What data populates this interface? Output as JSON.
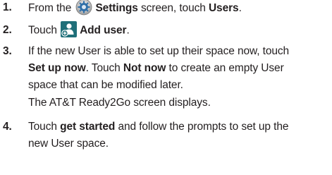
{
  "steps": [
    {
      "number": "1.",
      "text_before": "From the",
      "icon": "settings-gear-icon",
      "bold_label": "Settings",
      "text_after": " screen, touch ",
      "bold_target": "Users",
      "end": "."
    },
    {
      "number": "2.",
      "text_before": "Touch",
      "icon": "add-user-icon",
      "bold_label": "Add user",
      "end": "."
    },
    {
      "number": "3.",
      "line1": "If the new User is able to set up their space now, touch",
      "line2_bold": "Set up now",
      "line2_mid": ". Touch ",
      "line2_bold2": "Not now",
      "line2_end": " to create an empty User",
      "line3": "space that can be modified later.",
      "line4": "The AT&T Ready2Go screen displays."
    },
    {
      "number": "4.",
      "line1_before": "Touch ",
      "line1_bold": "get started",
      "line1_after": " and follow the prompts to set up the",
      "line2": "new User space."
    }
  ],
  "colors": {
    "text": "#231f20",
    "icon_teal": "#1f6f79",
    "settings_blue": "#2f6fa8"
  }
}
